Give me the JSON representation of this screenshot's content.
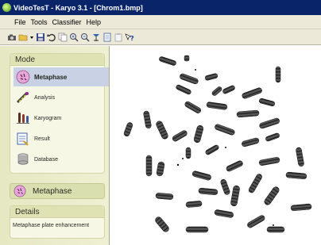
{
  "window": {
    "title": "VideoTesT - Karyo 3.1 - [Chrom1.bmp]"
  },
  "menu": {
    "items": [
      "File",
      "Tools",
      "Classifier",
      "Help"
    ]
  },
  "toolbar": {
    "icons": [
      "camera-icon",
      "open-folder-icon",
      "dropdown-arrow-icon",
      "save-icon",
      "undo-icon",
      "copy-icon",
      "zoom-in-icon",
      "zoom-out-icon",
      "flip-icon",
      "document-icon",
      "clipboard-icon",
      "help-icon"
    ]
  },
  "mode_panel": {
    "heading": "Mode",
    "items": [
      {
        "label": "Metaphase",
        "icon": "metaphase-icon",
        "selected": true
      },
      {
        "label": "Analysis",
        "icon": "analysis-icon"
      },
      {
        "label": "Karyogram",
        "icon": "karyogram-icon"
      },
      {
        "label": "Result",
        "icon": "result-icon"
      },
      {
        "label": "Database",
        "icon": "database-icon"
      }
    ]
  },
  "current_mode": {
    "label": "Metaphase"
  },
  "details": {
    "heading": "Details",
    "text": "Metaphase plate enhancement"
  },
  "image": {
    "content": "chromosome metaphase spread"
  },
  "colors": {
    "titlebar": "#0a246a",
    "panel": "#e5e8c2",
    "selected": "#c9d2e4"
  }
}
